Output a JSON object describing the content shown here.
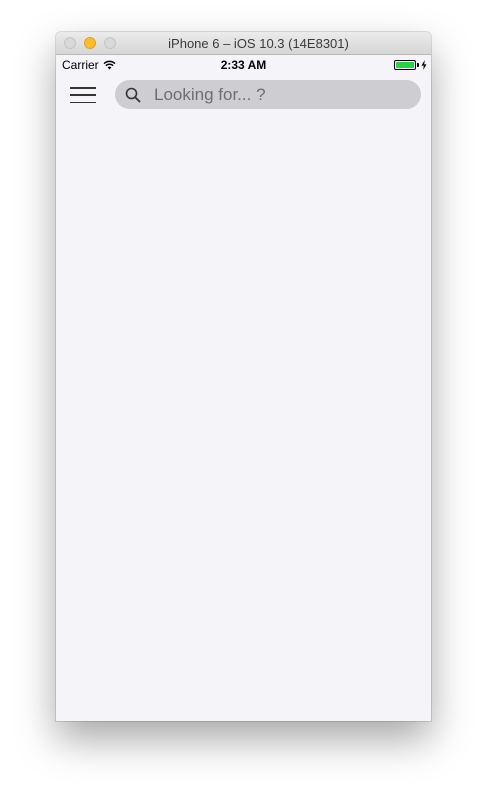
{
  "window": {
    "title": "iPhone 6 – iOS 10.3 (14E8301)"
  },
  "status_bar": {
    "carrier": "Carrier",
    "time": "2:33 AM",
    "battery_color": "#2bd144"
  },
  "nav": {
    "menu_icon": "hamburger-menu-icon",
    "search": {
      "placeholder": "Looking for... ?",
      "value": "",
      "icon": "search-icon"
    }
  },
  "colors": {
    "background": "#f4f4f9",
    "search_field": "#cdcdd2",
    "minimize_button": "#febc2e"
  }
}
